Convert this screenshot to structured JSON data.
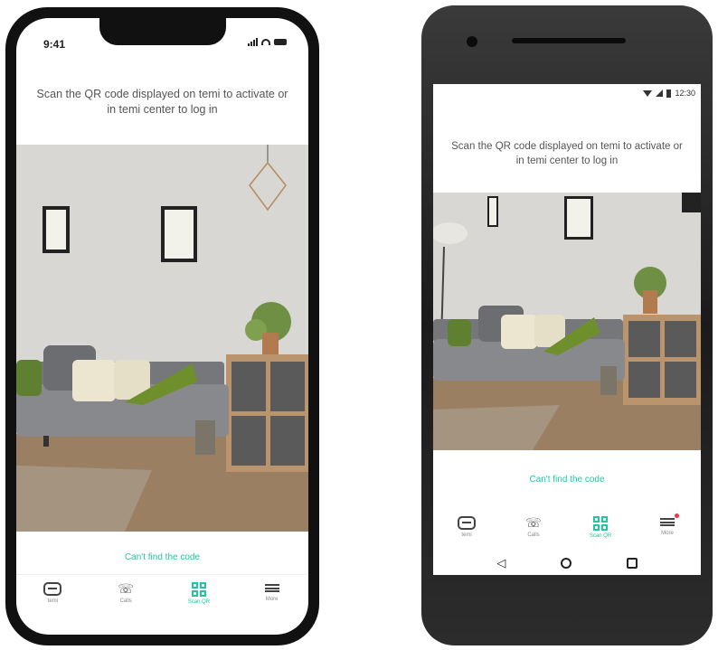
{
  "ios": {
    "status": {
      "time": "9:41"
    },
    "instruction": "Scan the QR code displayed on temi to activate or in temi center to log in",
    "cant_find": "Can't find the code",
    "tabs": [
      {
        "label": "temi",
        "icon": "temi-icon",
        "active": false
      },
      {
        "label": "Calls",
        "icon": "phone-icon",
        "active": false
      },
      {
        "label": "Scan QR",
        "icon": "qr-icon",
        "active": true
      },
      {
        "label": "More",
        "icon": "menu-icon",
        "active": false
      }
    ]
  },
  "android": {
    "status": {
      "time": "12:30"
    },
    "instruction": "Scan the QR code displayed on temi to activate or in temi center to log in",
    "cant_find": "Can't find the code",
    "tabs": [
      {
        "label": "temi",
        "icon": "temi-icon",
        "active": false
      },
      {
        "label": "Calls",
        "icon": "phone-icon",
        "active": false
      },
      {
        "label": "Scan QR",
        "icon": "qr-icon",
        "active": true
      },
      {
        "label": "More",
        "icon": "menu-icon",
        "active": false,
        "badge": true
      }
    ],
    "nav": [
      "back-icon",
      "home-icon",
      "recents-icon"
    ]
  },
  "colors": {
    "accent": "#22c7a2",
    "badge": "#e53950",
    "text": "#555555"
  }
}
